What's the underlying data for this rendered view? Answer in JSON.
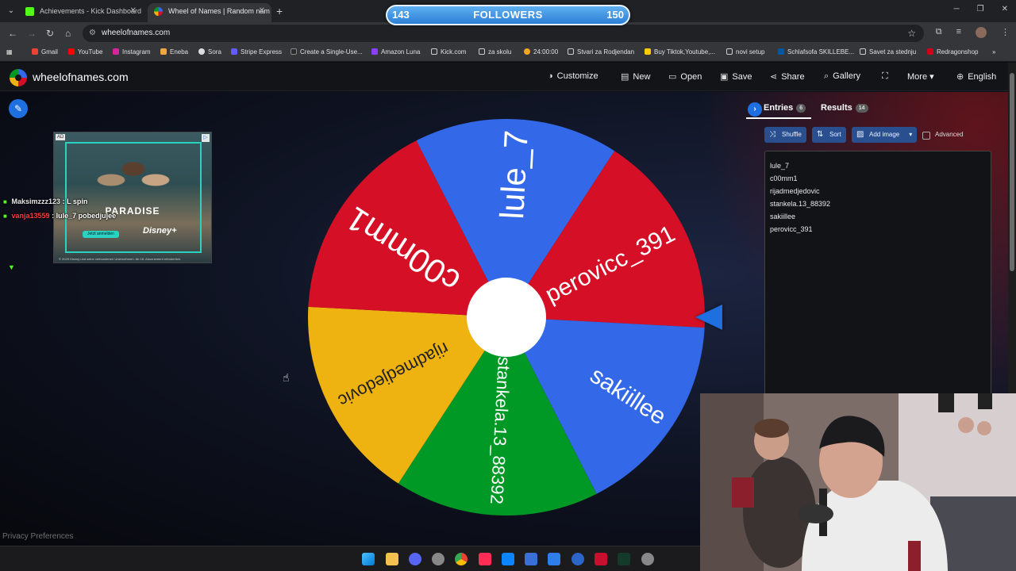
{
  "browser": {
    "tabs": [
      {
        "title": "Achievements - Kick Dashboard"
      },
      {
        "title": "Wheel of Names | Random nam"
      }
    ],
    "address": "wheelofnames.com",
    "bookmarks": [
      "Gmail",
      "YouTube",
      "Instagram",
      "Eneba",
      "Sora",
      "Stripe Express",
      "Create a Single-Use...",
      "Amazon Luna",
      "Kick.com",
      "za skolu",
      "24:00:00",
      "Stvari za Rodjendan",
      "Buy Tiktok,Youtube,...",
      "novi setup",
      "Schlafsofa SKILLEBE...",
      "Savet za stednju",
      "Redragonshop"
    ]
  },
  "followers_widget": {
    "current": "143",
    "label": "FOLLOWERS",
    "goal": "150"
  },
  "site": {
    "title": "wheelofnames.com",
    "menu": {
      "customize": "Customize",
      "new": "New",
      "open": "Open",
      "save": "Save",
      "share": "Share",
      "gallery": "Gallery",
      "more": "More",
      "language": "English"
    }
  },
  "ad": {
    "tag": "AD",
    "headline": "PARADISE",
    "cta": "Jetzt anmelden",
    "brand": "Disney+",
    "fineprint": "© 2025 Disney und seine verbundenen Unternehmen. Ab 18. Abonnement erforderlich."
  },
  "chat": [
    {
      "user": "Maksimzzz123",
      "message": ": L spin"
    },
    {
      "user": "vanja13559",
      "message": ": lule_7 pobedjujee"
    }
  ],
  "wheel": {
    "segments": [
      {
        "label": "lule_7",
        "color": "#3369e8"
      },
      {
        "label": "perovicc_391",
        "color": "#d50f25"
      },
      {
        "label": "sakiillee",
        "color": "#3369e8"
      },
      {
        "label": "stankela.13_88392",
        "color": "#009925"
      },
      {
        "label": "rijadmedjedovic",
        "color": "#eeb211"
      },
      {
        "label": "c00mm1",
        "color": "#d50f25"
      }
    ]
  },
  "panel": {
    "tab_entries": "Entries",
    "entries_count": "6",
    "tab_results": "Results",
    "results_count": "14",
    "shuffle": "Shuffle",
    "sort": "Sort",
    "add_image": "Add image",
    "advanced": "Advanced",
    "entries": [
      "lule_7",
      "c00mm1",
      "rijadmedjedovic",
      "stankela.13_88392",
      "sakiillee",
      "perovicc_391"
    ]
  },
  "footer": {
    "privacy": "Privacy Preferences"
  }
}
